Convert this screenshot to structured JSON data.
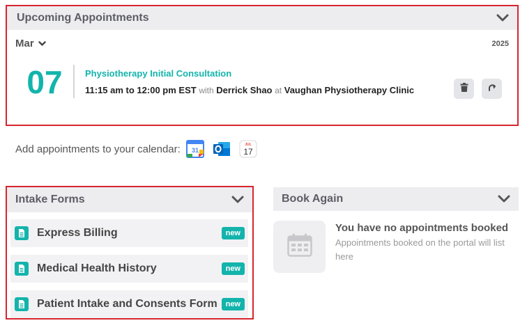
{
  "upcoming": {
    "title": "Upcoming Appointments",
    "month": "Mar",
    "year": "2025",
    "appointment": {
      "day": "07",
      "name": "Physiotherapy Initial Consultation",
      "time": "11:15 am to 12:00 pm EST",
      "with_word": "with",
      "practitioner": "Derrick Shao",
      "at_word": "at",
      "clinic": "Vaughan Physiotherapy Clinic"
    },
    "actions": [
      "trash-icon",
      "reschedule-icon"
    ]
  },
  "calendar": {
    "label": "Add appointments to your calendar:",
    "google_day": "31",
    "apple_month": "JUL",
    "apple_day": "17",
    "icons": [
      "google-calendar-icon",
      "outlook-icon",
      "apple-calendar-icon"
    ]
  },
  "intake": {
    "title": "Intake Forms",
    "forms": [
      {
        "label": "Express Billing",
        "badge": "new"
      },
      {
        "label": "Medical Health History",
        "badge": "new"
      },
      {
        "label": "Patient Intake and Consents Form",
        "badge": "new"
      }
    ]
  },
  "book_again": {
    "title": "Book Again",
    "empty_title": "You have no appointments booked",
    "empty_sub": "Appointments booked on the portal will list here"
  },
  "colors": {
    "accent": "#13b4ac",
    "highlight_border": "#d7252f",
    "header_bg": "#ededf0"
  }
}
